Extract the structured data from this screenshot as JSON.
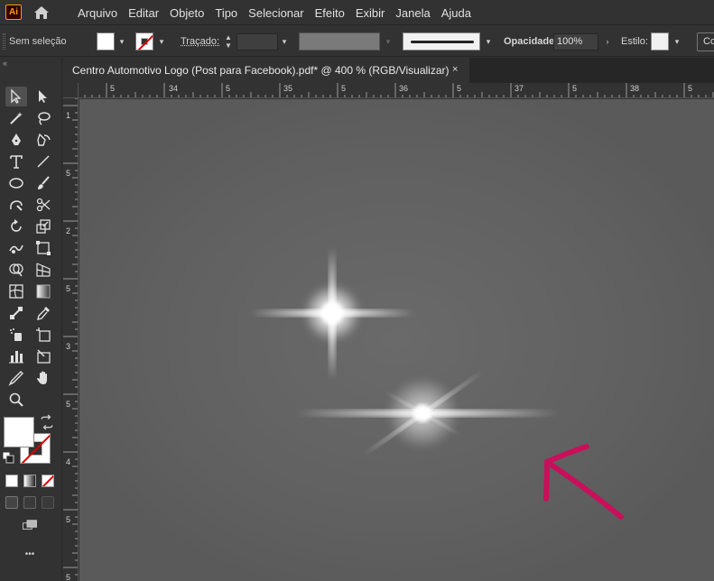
{
  "app": {
    "logo_text": "Ai"
  },
  "menu": [
    "Arquivo",
    "Editar",
    "Objeto",
    "Tipo",
    "Selecionar",
    "Efeito",
    "Exibir",
    "Janela",
    "Ajuda"
  ],
  "control_bar": {
    "selection_status": "Sem seleção",
    "stroke_label": "Traçado:",
    "opacity_label": "Opacidade:",
    "opacity_value": "100%",
    "style_label": "Estilo:",
    "cut_button": "Co",
    "fill_color": "#ffffff",
    "stroke_color": "none"
  },
  "document": {
    "tab_title": "Centro Automotivo Logo (Post para Facebook).pdf* @ 400 % (RGB/Visualizar)",
    "close_glyph": "×"
  },
  "rulers": {
    "top_labels": [
      "5",
      "34",
      "5",
      "35",
      "5",
      "36",
      "5",
      "37",
      "5",
      "38",
      "5"
    ],
    "left_labels": [
      "1",
      "5",
      "2",
      "5",
      "3",
      "5",
      "4",
      "5",
      "5"
    ]
  },
  "toolbar": {
    "collapse_glyph": "«",
    "more_glyph": "•••"
  },
  "colors": {
    "ui_background": "#323232",
    "canvas": "#5c5c5c",
    "annotation_arrow": "#c8105a",
    "sparkle": "#ffffff"
  }
}
